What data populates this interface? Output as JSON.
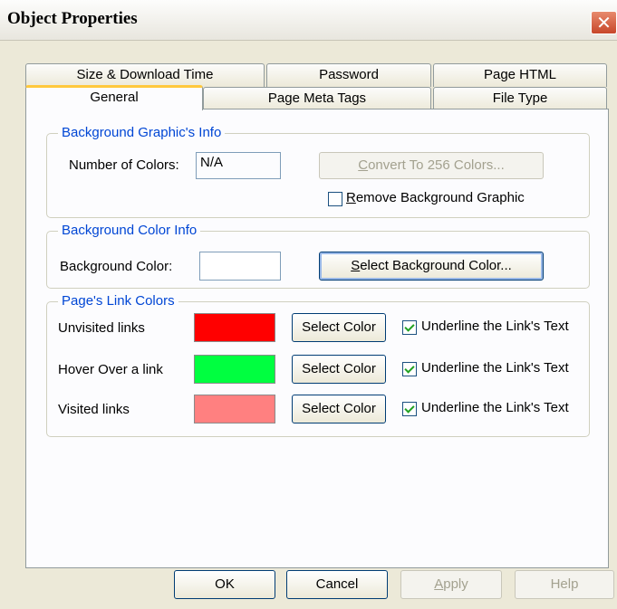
{
  "window": {
    "title": "Object Properties",
    "close_symbol": "✕"
  },
  "tabs_top": [
    {
      "label": "Size & Download Time"
    },
    {
      "label": "Password"
    },
    {
      "label": "Page HTML"
    }
  ],
  "tabs_bottom": [
    {
      "label": "General",
      "active": true
    },
    {
      "label": "Page Meta Tags"
    },
    {
      "label": "File Type"
    }
  ],
  "background_graphic": {
    "legend": "Background Graphic's Info",
    "colors_label": "Number of Colors:",
    "colors_value": "N/A",
    "convert_button": {
      "access_key": "C",
      "rest": "onvert To 256 Colors...",
      "enabled": false
    },
    "remove_checkbox": {
      "access_key": "R",
      "rest": "emove Background Graphic",
      "checked": false
    }
  },
  "background_color": {
    "legend": "Background Color Info",
    "label": "Background Color:",
    "swatch_color": "#ffffff",
    "select_button": {
      "access_key": "S",
      "rest": "elect Background Color..."
    }
  },
  "link_colors": {
    "legend": "Page's Link Colors",
    "rows": [
      {
        "label": "Unvisited links",
        "color": "#ff0000",
        "button": "Select Color",
        "underline_label": "Underline the Link's Text",
        "checked": true
      },
      {
        "label": "Hover Over a link",
        "color": "#00ff40",
        "button": "Select Color",
        "underline_label": "Underline the Link's Text",
        "checked": true
      },
      {
        "label": "Visited links",
        "color": "#ff8080",
        "button": "Select Color",
        "underline_label": "Underline the Link's Text",
        "checked": true
      }
    ]
  },
  "footer": {
    "ok": "OK",
    "cancel": "Cancel",
    "apply": {
      "access_key": "A",
      "rest": "pply",
      "enabled": false
    },
    "help": {
      "label": "Help",
      "enabled": false
    }
  }
}
